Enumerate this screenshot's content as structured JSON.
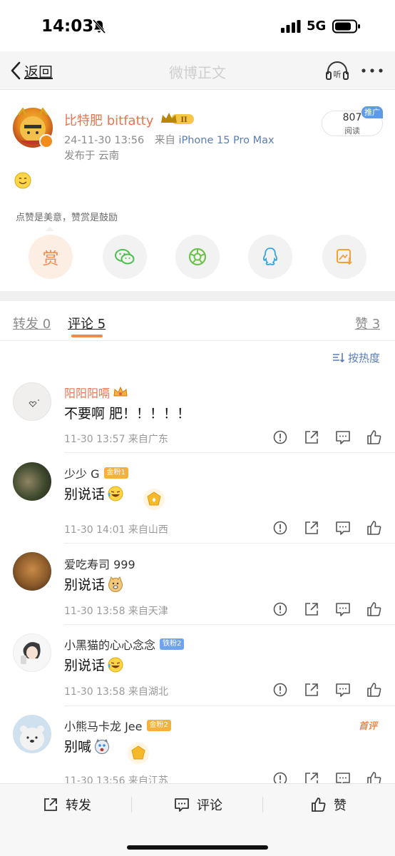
{
  "status_bar": {
    "time": "14:03",
    "network": "5G"
  },
  "nav": {
    "back_label": "返回",
    "title": "微博正文"
  },
  "post": {
    "author_name": "比特肥 bitfatty",
    "crown_level": "II",
    "timestamp": "24-11-30 13:56",
    "source_prefix": "来自",
    "source_device": "iPhone 15 Pro Max",
    "location": "发布于 云南",
    "read_count": "807",
    "read_label": "阅读",
    "promo_tag": "推广",
    "reward_caption": "点赞是美意，赞赏是鼓励",
    "reward_label": "赏"
  },
  "tabs": {
    "repost": "转发 0",
    "comments": "评论 5",
    "likes": "赞 3"
  },
  "sort_label": "按热度",
  "comments": [
    {
      "name": "阳阳阳嗝",
      "text": "不要啊 肥！！！！！",
      "time": "11-30 13:57  来自广东"
    },
    {
      "name": "少少 G",
      "badge": "金粉1",
      "text": "别说话",
      "time": "11-30 14:01  来自山西"
    },
    {
      "name": "爱吃寿司 999",
      "text": "别说话",
      "time": "11-30 13:58  来自天津"
    },
    {
      "name": "小黑猫的心心念念",
      "badge": "铁粉2",
      "text": "别说话",
      "time": "11-30 13:58  来自湖北"
    },
    {
      "name": "小熊马卡龙 Jee",
      "badge": "金粉2",
      "text": "别喊",
      "time": "11-30 13:56  来自江苏",
      "tag": "首评"
    }
  ],
  "bottom_bar": {
    "repost": "转发",
    "comment": "评论",
    "like": "赞"
  },
  "colors": {
    "accent": "#eb7350",
    "link": "#5b7db1",
    "orange": "#f0894a"
  },
  "icons": [
    "bell-slash-icon",
    "signal-icon",
    "battery-icon",
    "chevron-left-icon",
    "headphones-icon",
    "more-icon",
    "wechat-icon",
    "moments-icon",
    "qq-icon",
    "save-image-icon",
    "report-icon",
    "share-icon",
    "reply-icon",
    "thumbs-up-icon"
  ]
}
